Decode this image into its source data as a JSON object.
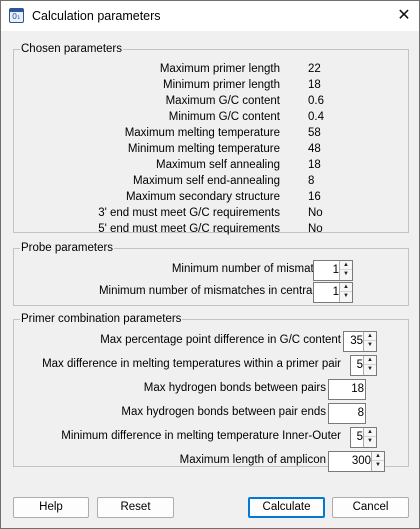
{
  "window": {
    "title": "Calculation parameters",
    "close_glyph": "✕",
    "app_icon": "calculator-window-icon",
    "app_icon_glyph": "0₁"
  },
  "chosen": {
    "title": "Chosen parameters",
    "rows": [
      {
        "label": "Maximum primer length",
        "value": "22"
      },
      {
        "label": "Minimum primer length",
        "value": "18"
      },
      {
        "label": "Maximum G/C content",
        "value": "0.6"
      },
      {
        "label": "Minimum G/C content",
        "value": "0.4"
      },
      {
        "label": "Maximum melting temperature",
        "value": "58"
      },
      {
        "label": "Minimum melting temperature",
        "value": "48"
      },
      {
        "label": "Maximum self annealing",
        "value": "18"
      },
      {
        "label": "Maximum self end-annealing",
        "value": "8"
      },
      {
        "label": "Maximum secondary structure",
        "value": "16"
      },
      {
        "label": "3' end must meet G/C requirements",
        "value": "No"
      },
      {
        "label": "5' end must meet G/C requirements",
        "value": "No"
      }
    ]
  },
  "probe": {
    "title": "Probe parameters",
    "min_mismatches": {
      "label": "Minimum number of mismatches",
      "value": "1"
    },
    "min_mismatches_central": {
      "label": "Minimum number of mismatches in central part",
      "value": "1"
    }
  },
  "primer_combo": {
    "title": "Primer combination parameters",
    "max_pct_gc_diff": {
      "label": "Max percentage point difference in G/C content",
      "value": "35"
    },
    "max_tm_diff": {
      "label": "Max difference in melting temperatures within a primer pair",
      "value": "5"
    },
    "max_hbonds_pairs": {
      "label": "Max hydrogen bonds between pairs",
      "value": "18"
    },
    "max_hbonds_ends": {
      "label": "Max hydrogen bonds between pair ends",
      "value": "8"
    },
    "min_tm_inner_outer": {
      "label": "Minimum difference in melting temperature Inner-Outer",
      "value": "5"
    },
    "max_amplicon": {
      "label": "Maximum length of amplicon",
      "value": "300"
    }
  },
  "spin": {
    "up_glyph": "▲",
    "down_glyph": "▼"
  },
  "buttons": {
    "help": "Help",
    "reset": "Reset",
    "calculate": "Calculate",
    "cancel": "Cancel"
  },
  "colors": {
    "default_button_border": "#0078d4"
  }
}
